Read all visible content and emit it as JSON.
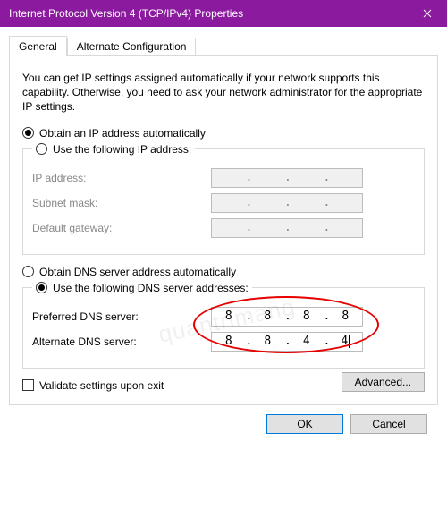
{
  "window": {
    "title": "Internet Protocol Version 4 (TCP/IPv4) Properties"
  },
  "tabs": {
    "general": "General",
    "alternate": "Alternate Configuration"
  },
  "intro": "You can get IP settings assigned automatically if your network supports this capability. Otherwise, you need to ask your network administrator for the appropriate IP settings.",
  "ip_section": {
    "auto_label": "Obtain an IP address automatically",
    "manual_label": "Use the following IP address:",
    "ip": "IP address:",
    "subnet": "Subnet mask:",
    "gateway": "Default gateway:"
  },
  "dns_section": {
    "auto_label": "Obtain DNS server address automatically",
    "manual_label": "Use the following DNS server addresses:",
    "preferred_label": "Preferred DNS server:",
    "alternate_label": "Alternate DNS server:",
    "preferred": {
      "o1": "8",
      "o2": "8",
      "o3": "8",
      "o4": "8"
    },
    "alternate": {
      "o1": "8",
      "o2": "8",
      "o3": "4",
      "o4": "4"
    }
  },
  "validate_label": "Validate settings upon exit",
  "advanced_label": "Advanced...",
  "buttons": {
    "ok": "OK",
    "cancel": "Cancel"
  },
  "watermark": "quantrimang"
}
